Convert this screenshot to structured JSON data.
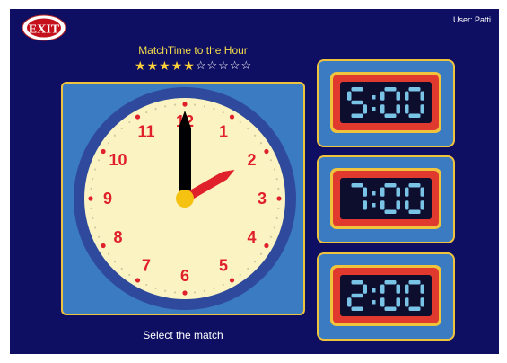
{
  "header": {
    "user_label": "User: Patti",
    "exit_label": "EXIT"
  },
  "activity": {
    "title": "MatchTime to the Hour",
    "rating": 5,
    "rating_max": 10
  },
  "clock": {
    "numbers": [
      "12",
      "1",
      "2",
      "3",
      "4",
      "5",
      "6",
      "7",
      "8",
      "9",
      "10",
      "11"
    ],
    "hour": 2,
    "minute": 0
  },
  "prompt": "Select the match",
  "choices": [
    {
      "time": "5:00"
    },
    {
      "time": "7:00"
    },
    {
      "time": "2:00"
    }
  ],
  "colors": {
    "background": "#0e0e63",
    "panel": "#3b7bc1",
    "panel_border": "#f0c33c",
    "clock_face": "#fbf4c2",
    "clock_rim": "#2f4a9c",
    "numbers": "#e0202a",
    "hour_hand": "#e0202a",
    "minute_hand": "#000000",
    "lcd_frame": "#e03a2f",
    "lcd_screen": "#0d0d2e",
    "lcd_digits": "#79c3e6"
  }
}
